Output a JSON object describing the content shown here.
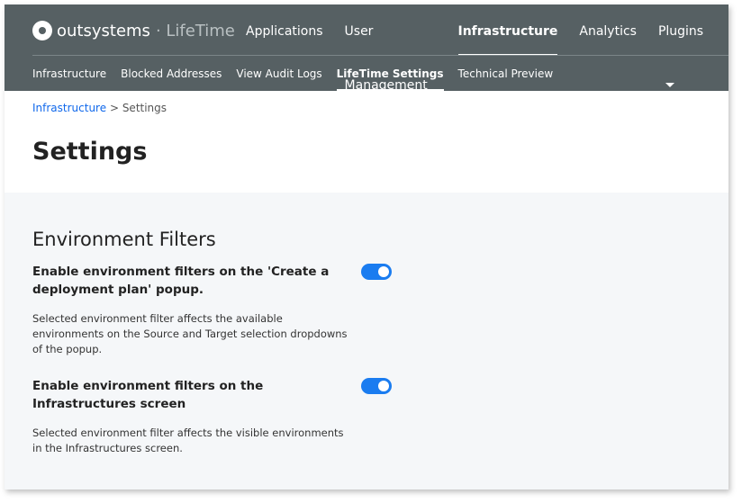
{
  "header": {
    "brand": "outsystems",
    "product": "LifeTime",
    "nav": [
      "Applications",
      "User Management",
      "Infrastructure",
      "Analytics",
      "Plugins"
    ],
    "active_nav": "Infrastructure",
    "subnav": [
      "Infrastructure",
      "Blocked Addresses",
      "View Audit Logs",
      "LifeTime Settings",
      "Technical Preview"
    ],
    "active_subnav": "LifeTime Settings"
  },
  "breadcrumb": {
    "link": "Infrastructure",
    "sep": " > ",
    "current": "Settings"
  },
  "page_title": "Settings",
  "section": {
    "title": "Environment Filters",
    "options": [
      {
        "label": "Enable environment filters on the 'Create a deployment plan' popup.",
        "desc": "Selected environment filter affects the available environments on the Source and Target selection dropdowns of the popup.",
        "enabled": true
      },
      {
        "label": "Enable environment filters on the Infrastructures screen",
        "desc": "Selected environment filter affects the visible environments in the Infrastructures screen.",
        "enabled": true
      }
    ]
  },
  "colors": {
    "header": "#566063",
    "accent": "#1a7cf0",
    "link": "#1068eb"
  }
}
